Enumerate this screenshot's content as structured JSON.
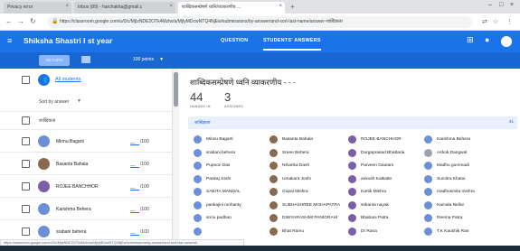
{
  "browser": {
    "tabs": [
      {
        "label": "Privacy error",
        "active": false
      },
      {
        "label": "Inbox (89) - harchakha@gmail.c",
        "active": false
      },
      {
        "label": "शाब्दिकसम्प्रेषणे ध्वनि/व्याकरणीय ...",
        "active": true
      }
    ],
    "url": "https://classroom.google.com/u/0/c/MjIzNDE2OTk4MzIw/a/MjIyMDcwNTQ4NjEw/submissions/by-answer/and-sort-last-name/answer-शाब्दिकता"
  },
  "header": {
    "class_title": "Shiksha Shastri I st year",
    "tabs": [
      {
        "label": "QUESTION",
        "active": false
      },
      {
        "label": "STUDENTS' ANSWERS",
        "active": true
      }
    ]
  },
  "toolbar": {
    "return_label": "RETURN",
    "points_label": "100 points"
  },
  "left": {
    "all_students_label": "All students",
    "sort_label": "Sort by answer",
    "group_label": "शाब्दिकता",
    "students": [
      {
        "name": "Minnu Bagarti",
        "grade_blank": "__",
        "grade_total": "/100",
        "color": "#6d8fd6"
      },
      {
        "name": "Basanta Bahala",
        "grade_blank": "__",
        "grade_total": "/100",
        "color": "#8a6a4e"
      },
      {
        "name": "ROJEE BANCHHOR",
        "grade_blank": "__",
        "grade_total": "/100",
        "color": "#7b5ea7"
      },
      {
        "name": "Karishma Behera",
        "grade_blank": "__",
        "grade_total": "/100",
        "color": "#6d8fd6"
      },
      {
        "name": "srabani behera",
        "grade_blank": "__",
        "grade_total": "/100",
        "color": "#6d8fd6"
      }
    ]
  },
  "right": {
    "assignment_title": "शाब्दिकसम्प्रेषणे ध्वनि व्याकरणीय - - -",
    "handed_in_count": "44",
    "handed_in_label": "HANDED IN",
    "assigned_count": "3",
    "assigned_label": "ASSIGNED",
    "group_header": "शाब्दिकता",
    "group_count": "41",
    "grid": [
      [
        {
          "name": "Minnu Bagarti",
          "color": "#6d8fd6"
        },
        {
          "name": "Basanta Bahala",
          "color": "#8a6a4e"
        },
        {
          "name": "ROJEE BANCHHOR",
          "color": "#7b5ea7"
        },
        {
          "name": "Karishma Behera",
          "color": "#6d8fd6"
        }
      ],
      [
        {
          "name": "srabani behera",
          "color": "#6d8fd6"
        },
        {
          "name": "Sreee Behera",
          "color": "#8a6a4e"
        },
        {
          "name": "Durgaprasad Bhattarai",
          "color": "#7b5ea7"
        },
        {
          "name": "Ashok Dangwal",
          "color": "#9aa3ad"
        }
      ],
      [
        {
          "name": "Pupoon Das",
          "color": "#6d8fd6"
        },
        {
          "name": "Niharika Dash",
          "color": "#8a6a4e"
        },
        {
          "name": "Parveen Gautam",
          "color": "#7b5ea7"
        },
        {
          "name": "Madhu gummadi",
          "color": "#6d8fd6"
        }
      ],
      [
        {
          "name": "Pankaj Joshi",
          "color": "#6d8fd6"
        },
        {
          "name": "Umakant Joshi",
          "color": "#8a6a4e"
        },
        {
          "name": "ankush Kalkatte",
          "color": "#7b5ea7"
        },
        {
          "name": "Sumitra Khatoi",
          "color": "#6d8fd6"
        }
      ],
      [
        {
          "name": "SABITA MANDAL",
          "color": "#6d8fd6"
        },
        {
          "name": "Gopal Mishra",
          "color": "#8a6a4e"
        },
        {
          "name": "Kartik Mishra",
          "color": "#7b5ea7"
        },
        {
          "name": "madhusmita mishra",
          "color": "#6d8fd6"
        }
      ],
      [
        {
          "name": "pankajini mohanty",
          "color": "#6d8fd6"
        },
        {
          "name": "SUBHASHREE MOHAPATRA",
          "color": "#8a6a4e"
        },
        {
          "name": "srikanta nayak",
          "color": "#7b5ea7"
        },
        {
          "name": "Kamala Nellur",
          "color": "#6d8fd6"
        }
      ],
      [
        {
          "name": "sonu padhan",
          "color": "#6d8fd6"
        },
        {
          "name": "DIWYARASHMI PANIGRAHI",
          "color": "#8a6a4e"
        },
        {
          "name": "Bhabani Patra",
          "color": "#7b5ea7"
        },
        {
          "name": "Reema Patra",
          "color": "#6d8fd6"
        }
      ],
      [
        {
          "name": "",
          "color": "#6d8fd6"
        },
        {
          "name": "Bhat Ramu",
          "color": "#8a6a4e"
        },
        {
          "name": "Dr Rana",
          "color": "#7b5ea7"
        },
        {
          "name": "T.K Kaushik Ran",
          "color": "#6d8fd6"
        }
      ]
    ]
  },
  "status_url": "https://classroom.google.com/u/0/c/MjIzNDE2OTk4MzIw/a/MjIyMDcwNTQ4NjEw/submissions/by-answer/and-sort-last-name/all"
}
